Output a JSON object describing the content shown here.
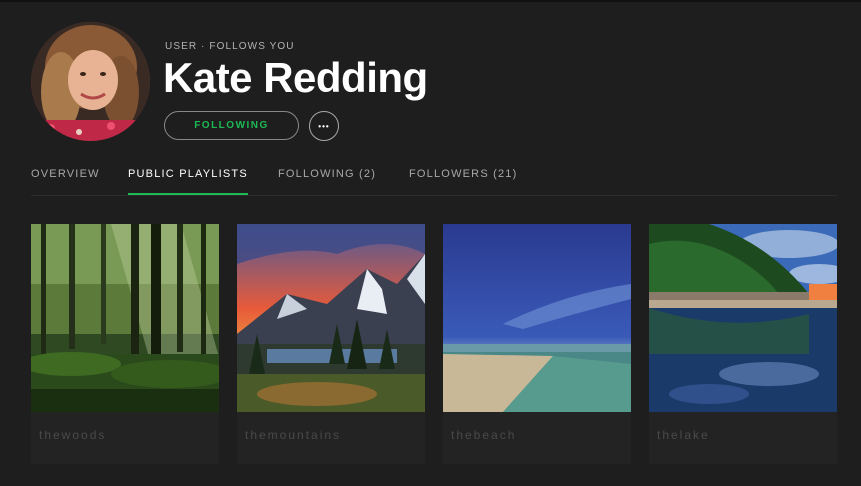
{
  "profile": {
    "subtitle": "USER · FOLLOWS YOU",
    "name": "Kate Redding",
    "follow_label": "FOLLOWING",
    "more_label": "•••"
  },
  "tabs": [
    {
      "label": "OVERVIEW",
      "active": false
    },
    {
      "label": "PUBLIC PLAYLISTS",
      "active": true
    },
    {
      "label": "FOLLOWING (2)",
      "active": false
    },
    {
      "label": "FOLLOWERS (21)",
      "active": false
    }
  ],
  "playlists": [
    {
      "name": "thewoods",
      "image": "forest"
    },
    {
      "name": "themountains",
      "image": "mountains"
    },
    {
      "name": "thebeach",
      "image": "beach"
    },
    {
      "name": "thelake",
      "image": "lake"
    }
  ],
  "colors": {
    "accent": "#1db954",
    "background": "#1e1e1e"
  },
  "icons": {
    "more": "ellipsis-icon"
  }
}
